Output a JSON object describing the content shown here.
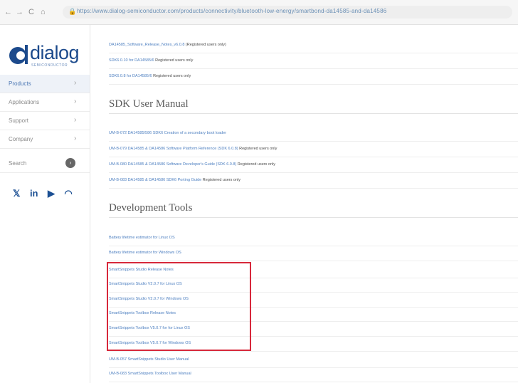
{
  "browser": {
    "back": "←",
    "forward": "→",
    "reload": "C",
    "home": "⌂",
    "lock": "🔒",
    "url": "https://www.dialog-semiconductor.com/products/connectivity/bluetooth-low-energy/smartbond-da14585-and-da14586"
  },
  "sidebar": {
    "logo_text": "dialog",
    "logo_sub": "SEMICONDUCTOR",
    "items": [
      {
        "label": "Products",
        "chevron": "›"
      },
      {
        "label": "Applications",
        "chevron": "›"
      },
      {
        "label": "Support",
        "chevron": "›"
      },
      {
        "label": "Company",
        "chevron": "›"
      }
    ],
    "search": {
      "label": "Search",
      "button": "›"
    },
    "social": [
      "𝕏",
      "in",
      "▶",
      "◠"
    ]
  },
  "top_links": [
    {
      "link": "DA14585_Software_Release_Notes_v6.0.8",
      "suffix": " (Registered users only)"
    },
    {
      "link": "SDK6.0.10 for DA14585/6",
      "suffix": " Registered users only"
    },
    {
      "link": "SDK6.0.8 for DA14585/6",
      "suffix": " Registered users only"
    }
  ],
  "sdk_manual": {
    "title": "SDK User Manual",
    "links": [
      {
        "link": "UM-B-072 DA14585/586 SDK6 Creation of a secondary boot loader",
        "suffix": ""
      },
      {
        "link": "UM-B-079 DA14585 & DA14586 Software Platform Reference (SDK 6.0.8)",
        "suffix": " Registered users only"
      },
      {
        "link": "UM-B-080 DA14585 & DA14586 Software Developer's Guide (SDK 6.0.8)",
        "suffix": " Registered users only"
      },
      {
        "link": "UM-B-083 DA14585 & DA14586 SDK6 Porting Guide",
        "suffix": " Registered users only"
      }
    ]
  },
  "dev_tools": {
    "title": "Development Tools",
    "links": [
      {
        "link": "Battery lifetime estimator for Linux OS",
        "suffix": ""
      },
      {
        "link": "Battery lifetime estimator for Windows OS",
        "suffix": ""
      },
      {
        "link": "SmartSnippets Studio Release Notes",
        "suffix": ""
      },
      {
        "link": "SmartSnippets Studio V2.0.7 for Linux OS",
        "suffix": ""
      },
      {
        "link": "SmartSnippets Studio V2.0.7 for Windows OS",
        "suffix": ""
      },
      {
        "link": "SmartSnippets Toolbox Release Notes",
        "suffix": ""
      },
      {
        "link": "SmartSnippets Toolbox V5.0.7 for for Linux OS",
        "suffix": ""
      },
      {
        "link": "SmartSnippets Toolbox V5.0.7 for Windows OS",
        "suffix": ""
      },
      {
        "link": "UM-B-057 SmartSnippets Studio User Manual",
        "suffix": ""
      },
      {
        "link": "UM-B-083 SmartSnippets Toolbox User Manual",
        "suffix": ""
      }
    ]
  },
  "colors": {
    "link": "#4d7fc0",
    "highlight_border": "#d7283b",
    "brand": "#1c4a8c"
  }
}
